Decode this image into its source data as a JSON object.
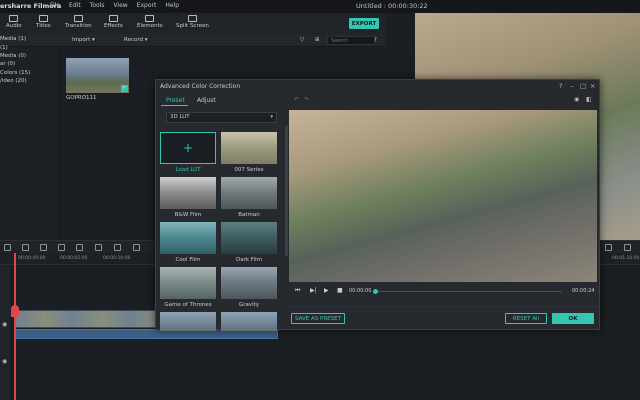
{
  "menubar": {
    "brand": "ersharre Filmora",
    "menus": [
      "File",
      "Edit",
      "Tools",
      "View",
      "Export",
      "Help"
    ],
    "project_title": "Untitled : 00:00:30:22"
  },
  "toolbar": {
    "items": [
      "Audio",
      "Titles",
      "Transition",
      "Effects",
      "Elements",
      "Split Screen"
    ],
    "export_label": "EXPORT"
  },
  "subbar": {
    "import_label": "Import",
    "record_label": "Record",
    "search_placeholder": "Search"
  },
  "library": {
    "items": [
      "Media (1)",
      "(1)",
      "Media (0)",
      "ar (0)",
      "Colors (15)",
      "/ideo (20)"
    ]
  },
  "media": {
    "clip_label": "GOPRO111"
  },
  "timeline": {
    "ticks": [
      "00:00:00:00",
      "00:00:05:00",
      "00:00:10:00",
      "00:01:10:00"
    ]
  },
  "dialog": {
    "title": "Advanced Color Correction",
    "tabs": [
      "Preset",
      "Adjust"
    ],
    "lut_select": "3D LUT",
    "presets": [
      "Load LUT",
      "007 Series",
      "B&W Film",
      "Batman",
      "Cool Film",
      "Dark Film",
      "Game of Thrones",
      "Gravity"
    ],
    "time_current": "00:00:00",
    "time_total": "00:00:24",
    "save_preset_label": "SAVE AS PRESET",
    "reset_label": "RESET All",
    "ok_label": "OK"
  },
  "colors": {
    "accent": "#33c6b0",
    "playhead": "#e04848"
  }
}
